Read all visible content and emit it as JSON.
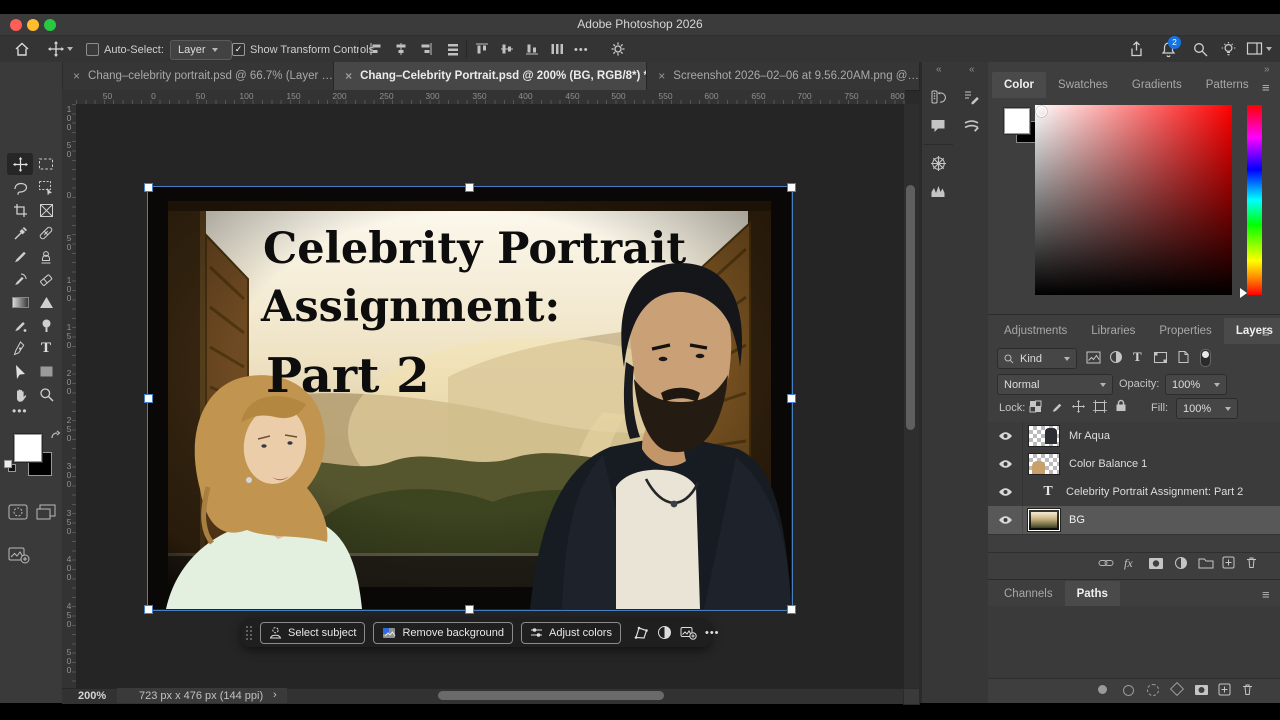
{
  "app": {
    "title": "Adobe Photoshop 2026",
    "badge": "2"
  },
  "glyphs": {
    "close": "×",
    "collapse": "«",
    "expand": "»",
    "menu": "≡",
    "more": "•••",
    "chev_right": "›",
    "check": "✓",
    "T": "T",
    "fx": "fx"
  },
  "options": {
    "auto_select": "Auto-Select:",
    "layer": "Layer",
    "show_transform": "Show Transform Controls"
  },
  "tabs": [
    {
      "label": "Chang–celebrity portrait.psd @ 66.7% (Layer …"
    },
    {
      "label": "Chang–Celebrity Portrait.psd @ 200% (BG, RGB/8*) *"
    },
    {
      "label": "Screenshot 2026–02–06 at 9.56.20AM.png @…"
    }
  ],
  "ruler_top": [
    "50",
    "0",
    "50",
    "100",
    "150",
    "200",
    "250",
    "300",
    "350",
    "400",
    "450",
    "500",
    "550",
    "600",
    "650",
    "700",
    "750",
    "800"
  ],
  "ruler_left": [
    "100",
    "50",
    "0",
    "50",
    "100",
    "150",
    "200",
    "250",
    "300",
    "350",
    "400",
    "450",
    "500"
  ],
  "artwork": {
    "line1": "Celebrity Portrait",
    "line2": "Assignment:",
    "line3": "Part 2"
  },
  "taskbar": {
    "select_subject": "Select subject",
    "remove_background": "Remove background",
    "adjust_colors": "Adjust colors"
  },
  "status": {
    "zoom": "200%",
    "info": "723 px x 476 px (144 ppi)"
  },
  "color_panel": {
    "tabs": [
      "Color",
      "Swatches",
      "Gradients",
      "Patterns"
    ]
  },
  "dock_tabs": [
    "Adjustments",
    "Libraries",
    "Properties",
    "Layers"
  ],
  "layers_panel": {
    "kind": "Kind",
    "blend": "Normal",
    "opacity_label": "Opacity:",
    "opacity": "100%",
    "lock": "Lock:",
    "fill_label": "Fill:",
    "fill": "100%"
  },
  "layers": [
    {
      "name": "Mr Aqua"
    },
    {
      "name": "Color Balance 1"
    },
    {
      "name": "Celebrity Portrait  Assignment:  Part 2"
    },
    {
      "name": "BG"
    }
  ],
  "channels_panel": {
    "tabs": [
      "Channels",
      "Paths"
    ]
  },
  "colors": {
    "accent_blue": "#1473e6",
    "handle_blue": "#477fc4",
    "hue_top": "#ff0000"
  }
}
